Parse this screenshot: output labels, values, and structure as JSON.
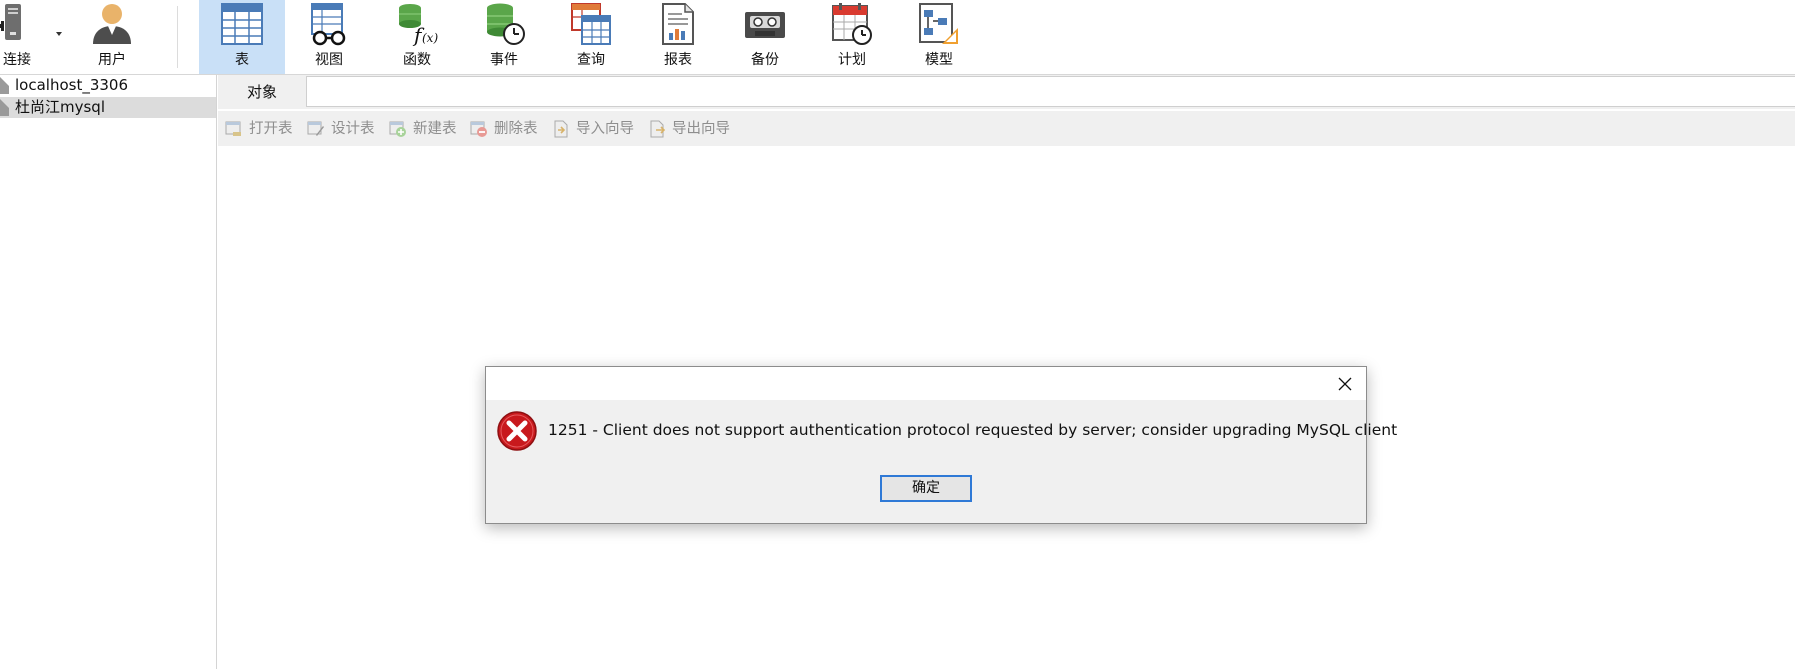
{
  "ribbon": {
    "buttons": [
      {
        "id": "connect",
        "label": "连接",
        "icon": "plug-server-icon",
        "has_dropdown": true
      },
      {
        "id": "user",
        "label": "用户",
        "icon": "user-icon"
      },
      {
        "id": "table",
        "label": "表",
        "icon": "table-icon",
        "active": true
      },
      {
        "id": "view",
        "label": "视图",
        "icon": "view-glasses-icon"
      },
      {
        "id": "function",
        "label": "函数",
        "icon": "function-fx-icon"
      },
      {
        "id": "event",
        "label": "事件",
        "icon": "event-clock-icon"
      },
      {
        "id": "query",
        "label": "查询",
        "icon": "query-icon"
      },
      {
        "id": "report",
        "label": "报表",
        "icon": "report-icon"
      },
      {
        "id": "backup",
        "label": "备份",
        "icon": "backup-tape-icon"
      },
      {
        "id": "schedule",
        "label": "计划",
        "icon": "calendar-schedule-icon"
      },
      {
        "id": "model",
        "label": "模型",
        "icon": "model-diagram-icon"
      }
    ]
  },
  "sidebar": {
    "connections": [
      {
        "label": "localhost_3306",
        "selected": false
      },
      {
        "label": "杜尚江mysql",
        "selected": true
      }
    ]
  },
  "object_panel": {
    "tab_label": "对象",
    "toolbar": [
      {
        "label": "打开表",
        "icon": "open-table-icon"
      },
      {
        "label": "设计表",
        "icon": "design-table-icon"
      },
      {
        "label": "新建表",
        "icon": "new-table-icon"
      },
      {
        "label": "删除表",
        "icon": "delete-table-icon"
      },
      {
        "label": "导入向导",
        "icon": "import-wizard-icon"
      },
      {
        "label": "导出向导",
        "icon": "export-wizard-icon"
      }
    ]
  },
  "dialog": {
    "message": "1251 - Client does not support authentication protocol requested by server; consider upgrading MySQL client",
    "ok_label": "确定",
    "icon": "error-icon"
  },
  "colors": {
    "active_tab_bg": "#c9e0f7",
    "error_red": "#c8191d",
    "focus_border": "#2f79d6",
    "disabled_text": "#8e8e8e"
  }
}
